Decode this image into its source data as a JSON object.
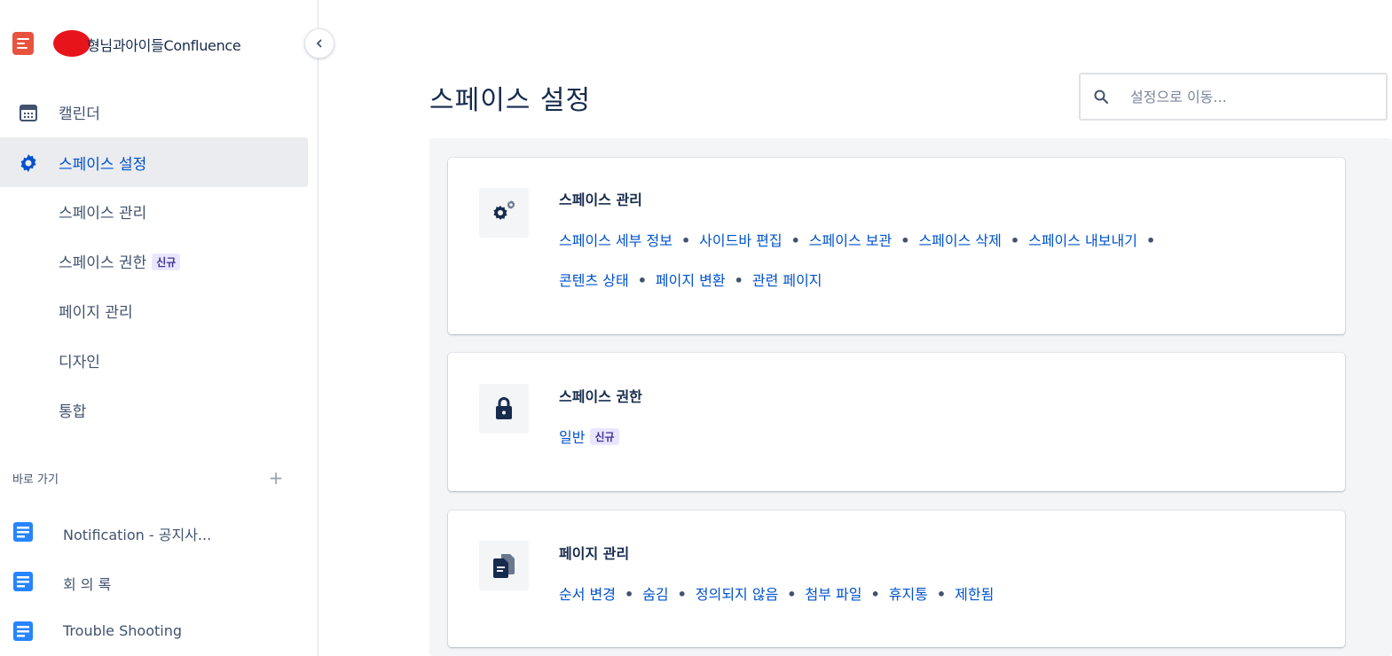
{
  "sidebar": {
    "space_name": "형님과아이들Confluence",
    "nav": {
      "calendar": "캘린더",
      "space_settings": "스페이스 설정"
    },
    "sub_items": {
      "space_management": "스페이스 관리",
      "space_permissions": "스페이스 권한",
      "new_badge": "신규",
      "page_management": "페이지 관리",
      "design": "디자인",
      "integration": "통합"
    },
    "shortcuts": {
      "title": "바로 가기",
      "add": "+",
      "items": [
        {
          "label": "Notification - 공지사..."
        },
        {
          "label": "회 의 록"
        },
        {
          "label": "Trouble Shooting"
        }
      ]
    }
  },
  "main": {
    "title": "스페이스 설정",
    "search": {
      "placeholder": "설정으로 이동..."
    },
    "cards": [
      {
        "title": "스페이스 관리",
        "icon": "gears-icon",
        "lines": [
          [
            "스페이스 세부 정보",
            "사이드바 편집",
            "스페이스 보관",
            "스페이스 삭제",
            "스페이스 내보내기"
          ],
          [
            "콘텐츠 상태",
            "페이지 변환",
            "관련 페이지"
          ]
        ]
      },
      {
        "title": "스페이스 권한",
        "icon": "lock-icon",
        "link": "일반",
        "badge": "신규"
      },
      {
        "title": "페이지 관리",
        "icon": "pages-icon",
        "lines": [
          [
            "순서 변경",
            "숨김",
            "정의되지 않음",
            "첨부 파일",
            "휴지통",
            "제한됨"
          ]
        ]
      }
    ]
  },
  "colors": {
    "link": "#0052cc",
    "text": "#172b4d",
    "muted": "#42526e",
    "active_bg": "#ebecf0",
    "panel_bg": "#f4f5f7",
    "badge_bg": "#eae6ff",
    "badge_text": "#403294",
    "logo": "#e8533f",
    "doc_icon": "#2684ff"
  }
}
